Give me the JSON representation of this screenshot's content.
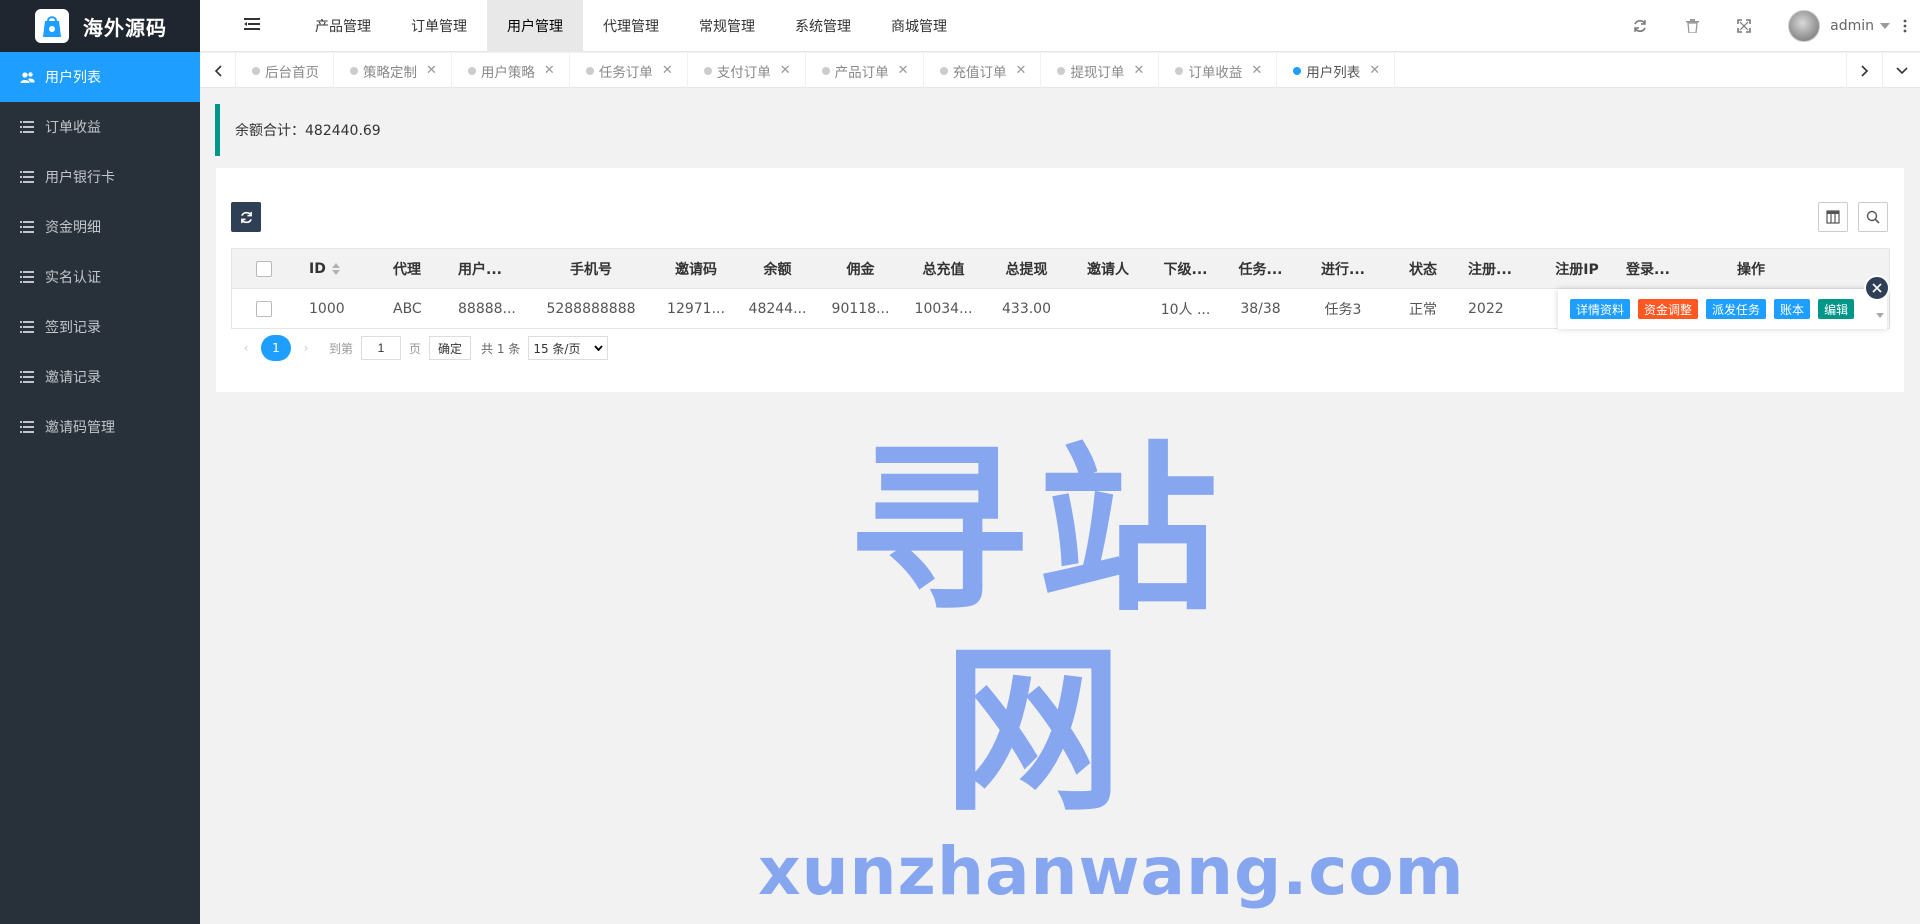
{
  "brand": {
    "name": "海外源码"
  },
  "sidebar": {
    "items": [
      {
        "label": "用户列表",
        "icon": "users-icon",
        "active": true
      },
      {
        "label": "订单收益",
        "icon": "list-icon"
      },
      {
        "label": "用户银行卡",
        "icon": "list-icon"
      },
      {
        "label": "资金明细",
        "icon": "list-icon"
      },
      {
        "label": "实名认证",
        "icon": "list-icon"
      },
      {
        "label": "签到记录",
        "icon": "list-icon"
      },
      {
        "label": "邀请记录",
        "icon": "list-icon"
      },
      {
        "label": "邀请码管理",
        "icon": "list-icon"
      }
    ]
  },
  "topnav": {
    "items": [
      "产品管理",
      "订单管理",
      "用户管理",
      "代理管理",
      "常规管理",
      "系统管理",
      "商城管理"
    ],
    "active_index": 2
  },
  "header": {
    "username": "admin"
  },
  "tabs": [
    {
      "label": "后台首页",
      "closable": false
    },
    {
      "label": "策略定制",
      "closable": true
    },
    {
      "label": "用户策略",
      "closable": true
    },
    {
      "label": "任务订单",
      "closable": true
    },
    {
      "label": "支付订单",
      "closable": true
    },
    {
      "label": "产品订单",
      "closable": true
    },
    {
      "label": "充值订单",
      "closable": true
    },
    {
      "label": "提现订单",
      "closable": true
    },
    {
      "label": "订单收益",
      "closable": true
    },
    {
      "label": "用户列表",
      "closable": true,
      "active": true
    }
  ],
  "summary": {
    "text": "余额合计：482440.69"
  },
  "table": {
    "headers": {
      "id": "ID",
      "agent": "代理",
      "user": "用户...",
      "phone": "手机号",
      "invite_code": "邀请码",
      "balance": "余额",
      "commission": "佣金",
      "recharge": "总充值",
      "withdraw": "总提现",
      "inviter": "邀请人",
      "subordinate": "下级...",
      "task": "任务...",
      "progress": "进行...",
      "status": "状态",
      "register": "注册...",
      "register_ip": "注册IP",
      "login": "登录...",
      "operation": "操作"
    },
    "rows": [
      {
        "id": "1000",
        "agent": "ABC",
        "user": "88888...",
        "phone": "5288888888",
        "invite_code": "12971...",
        "balance": "48244...",
        "commission": "90118...",
        "recharge": "10034...",
        "withdraw": "433.00",
        "inviter": "",
        "subordinate": "10人 ...",
        "task": "38/38",
        "progress": "任务3",
        "status": "正常",
        "register": "2022"
      }
    ],
    "row_actions": [
      "详情资料",
      "资金调整",
      "派发任务",
      "账本",
      "编辑"
    ]
  },
  "pager": {
    "current": "1",
    "goto_label": "到第",
    "page_input": "1",
    "page_unit": "页",
    "confirm": "确定",
    "total": "共 1 条",
    "page_size": "15 条/页"
  },
  "watermark": {
    "cn": "寻站网",
    "en": "xunzhanwang.com"
  },
  "colors": {
    "primary": "#1e9fff",
    "sidebar": "#28303a",
    "orange": "#ff5722",
    "teal": "#009688",
    "watermark": "#86a6ef"
  }
}
